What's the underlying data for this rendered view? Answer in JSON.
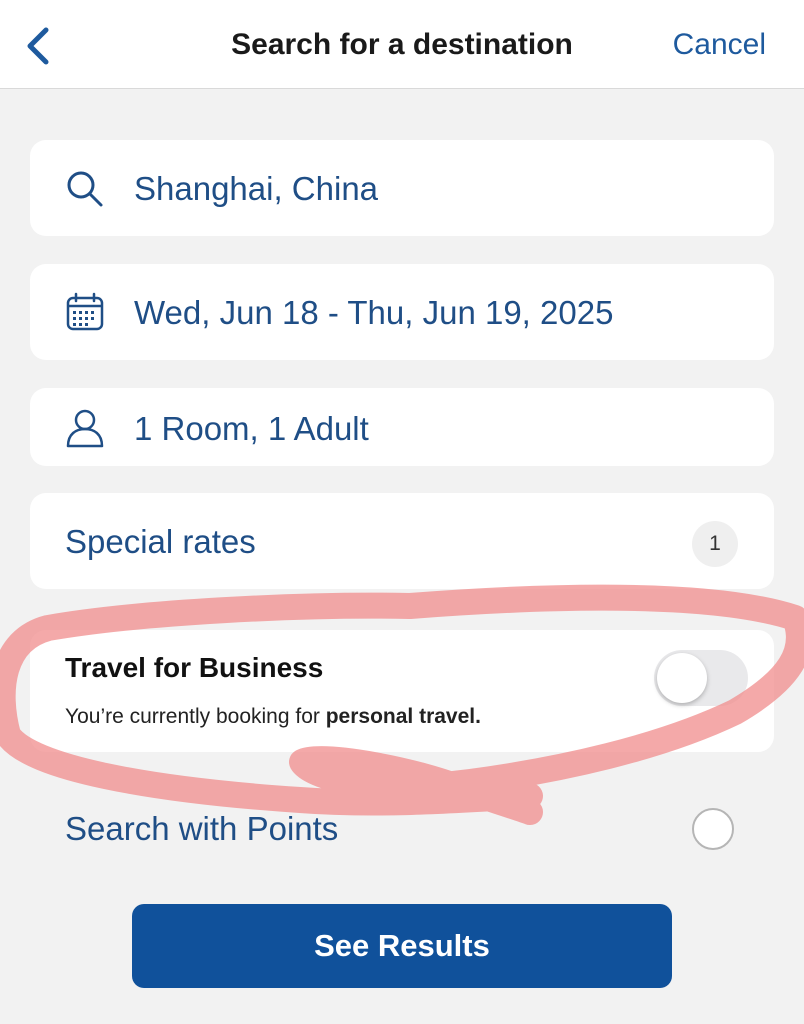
{
  "header": {
    "title": "Search for a destination",
    "cancel_label": "Cancel"
  },
  "search": {
    "destination": "Shanghai, China",
    "dates": "Wed, Jun 18 - Thu, Jun 19, 2025",
    "occupancy": "1 Room, 1 Adult"
  },
  "special_rates": {
    "label": "Special rates",
    "count": "1"
  },
  "business": {
    "title": "Travel for Business",
    "subtitle_prefix": "You’re currently booking for ",
    "subtitle_bold": "personal travel.",
    "toggle_on": false
  },
  "points": {
    "label": "Search with Points",
    "selected": false
  },
  "actions": {
    "see_results_label": "See Results"
  },
  "icons": {
    "back": "chevron-left-icon",
    "search": "search-icon",
    "calendar": "calendar-icon",
    "guests": "person-icon"
  },
  "colors": {
    "primary": "#10519b",
    "link_text": "#1f4e86",
    "annotation": "#f08c8c"
  }
}
